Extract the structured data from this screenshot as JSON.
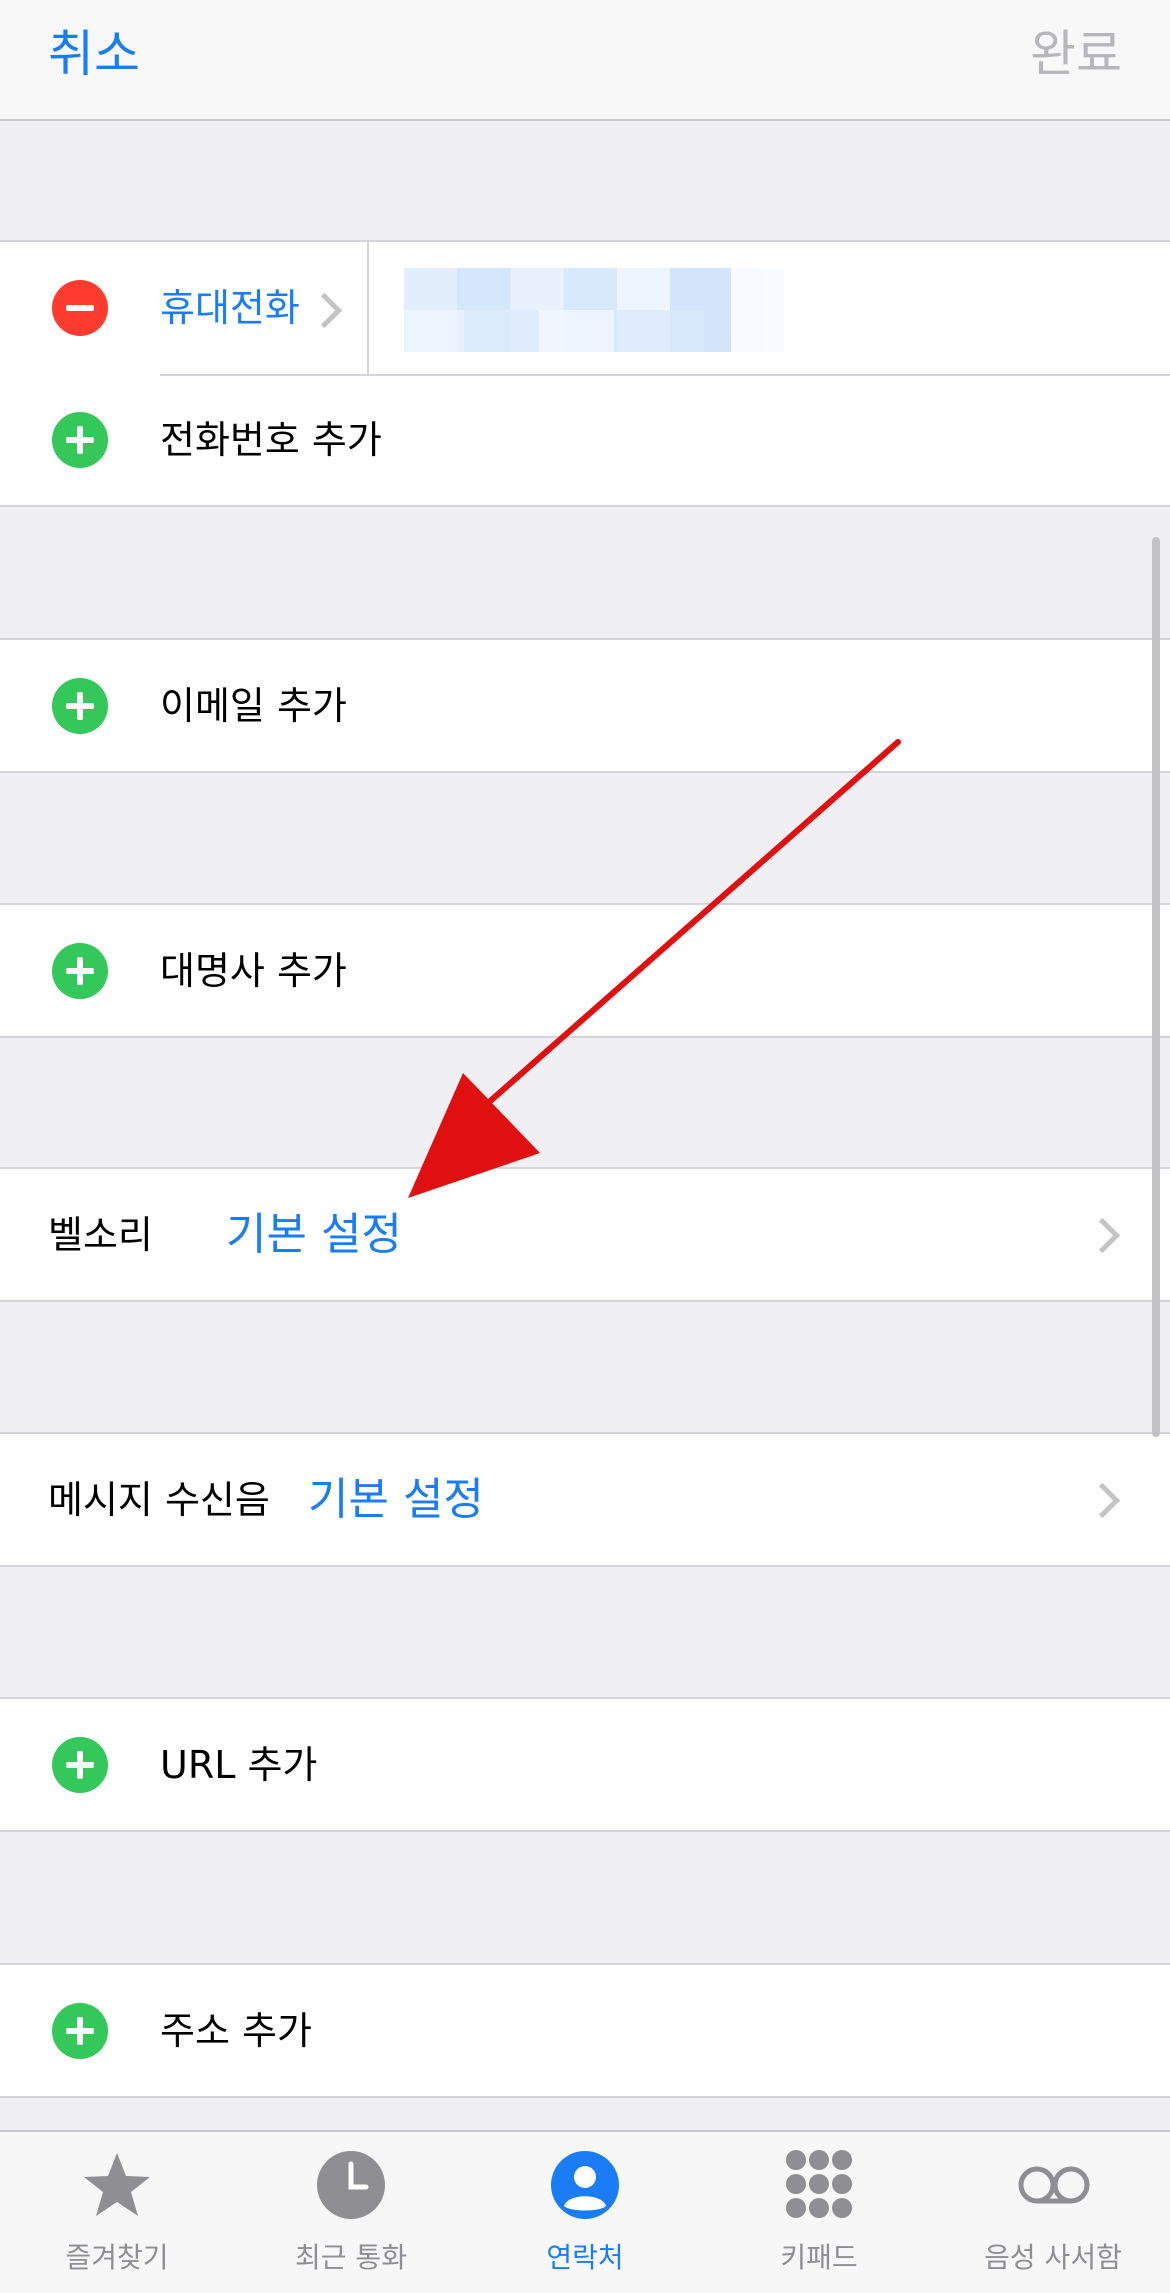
{
  "navbar": {
    "cancel": "취소",
    "done": "완료"
  },
  "phone_section": {
    "phone_label": "휴대전화",
    "add_phone": "전화번호 추가"
  },
  "email_section": {
    "add_email": "이메일 추가"
  },
  "pronoun_section": {
    "add_pronoun": "대명사 추가"
  },
  "ringtone": {
    "label": "벨소리",
    "value": "기본 설정"
  },
  "text_tone": {
    "label": "메시지 수신음",
    "value": "기본 설정"
  },
  "url_section": {
    "add_url": "URL 추가"
  },
  "address_section": {
    "add_address": "주소 추가"
  },
  "tabbar": {
    "active": "contacts",
    "tabs": [
      {
        "label": "즐겨찾기",
        "icon": "star-icon"
      },
      {
        "label": "최근 통화",
        "icon": "clock-icon"
      },
      {
        "label": "연락처",
        "icon": "person-icon"
      },
      {
        "label": "키패드",
        "icon": "keypad-icon"
      },
      {
        "label": "음성 사서함",
        "icon": "voicemail-icon"
      }
    ]
  },
  "colors": {
    "accent": "#1a7df5",
    "add": "#34c759",
    "remove": "#ff3b30",
    "annotation_arrow": "#e01010"
  }
}
